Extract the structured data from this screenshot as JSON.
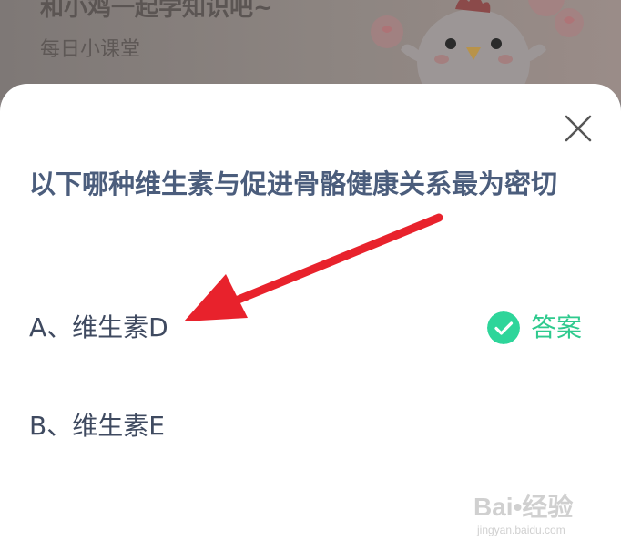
{
  "banner": {
    "title": "和小鸡一起学知识吧~",
    "subtitle": "每日小课堂"
  },
  "quiz": {
    "question": "以下哪种维生素与促进骨骼健康关系最为密切",
    "options": [
      {
        "label": "A、维生素D"
      },
      {
        "label": "B、维生素E"
      }
    ],
    "answer_label": "答案"
  },
  "watermark": {
    "logo": "Bai•经验",
    "url": "jingyan.baidu.com"
  },
  "colors": {
    "accent_green": "#2ed59a",
    "question_text": "#4b5d7c",
    "annotation_arrow": "#e8222c"
  },
  "icons": {
    "close": "close-icon",
    "check": "check-circle-icon",
    "mascot": "chicken-mascot-icon"
  }
}
